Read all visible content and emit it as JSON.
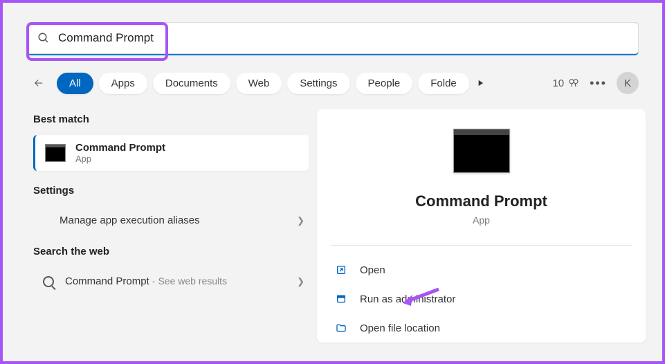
{
  "search": {
    "value": "Command Prompt"
  },
  "tabs": {
    "items": [
      "All",
      "Apps",
      "Documents",
      "Web",
      "Settings",
      "People",
      "Folde"
    ],
    "active_index": 0
  },
  "header_right": {
    "rewards_count": "10",
    "avatar_initial": "K"
  },
  "left": {
    "best_match_label": "Best match",
    "best_match": {
      "title": "Command Prompt",
      "subtitle": "App"
    },
    "settings_label": "Settings",
    "settings_items": [
      {
        "label": "Manage app execution aliases"
      }
    ],
    "web_label": "Search the web",
    "web_items": [
      {
        "title": "Command Prompt",
        "subtitle": "- See web results"
      }
    ]
  },
  "preview": {
    "title": "Command Prompt",
    "subtitle": "App",
    "actions": [
      {
        "icon": "open",
        "label": "Open"
      },
      {
        "icon": "shield",
        "label": "Run as administrator"
      },
      {
        "icon": "folder",
        "label": "Open file location"
      }
    ]
  }
}
